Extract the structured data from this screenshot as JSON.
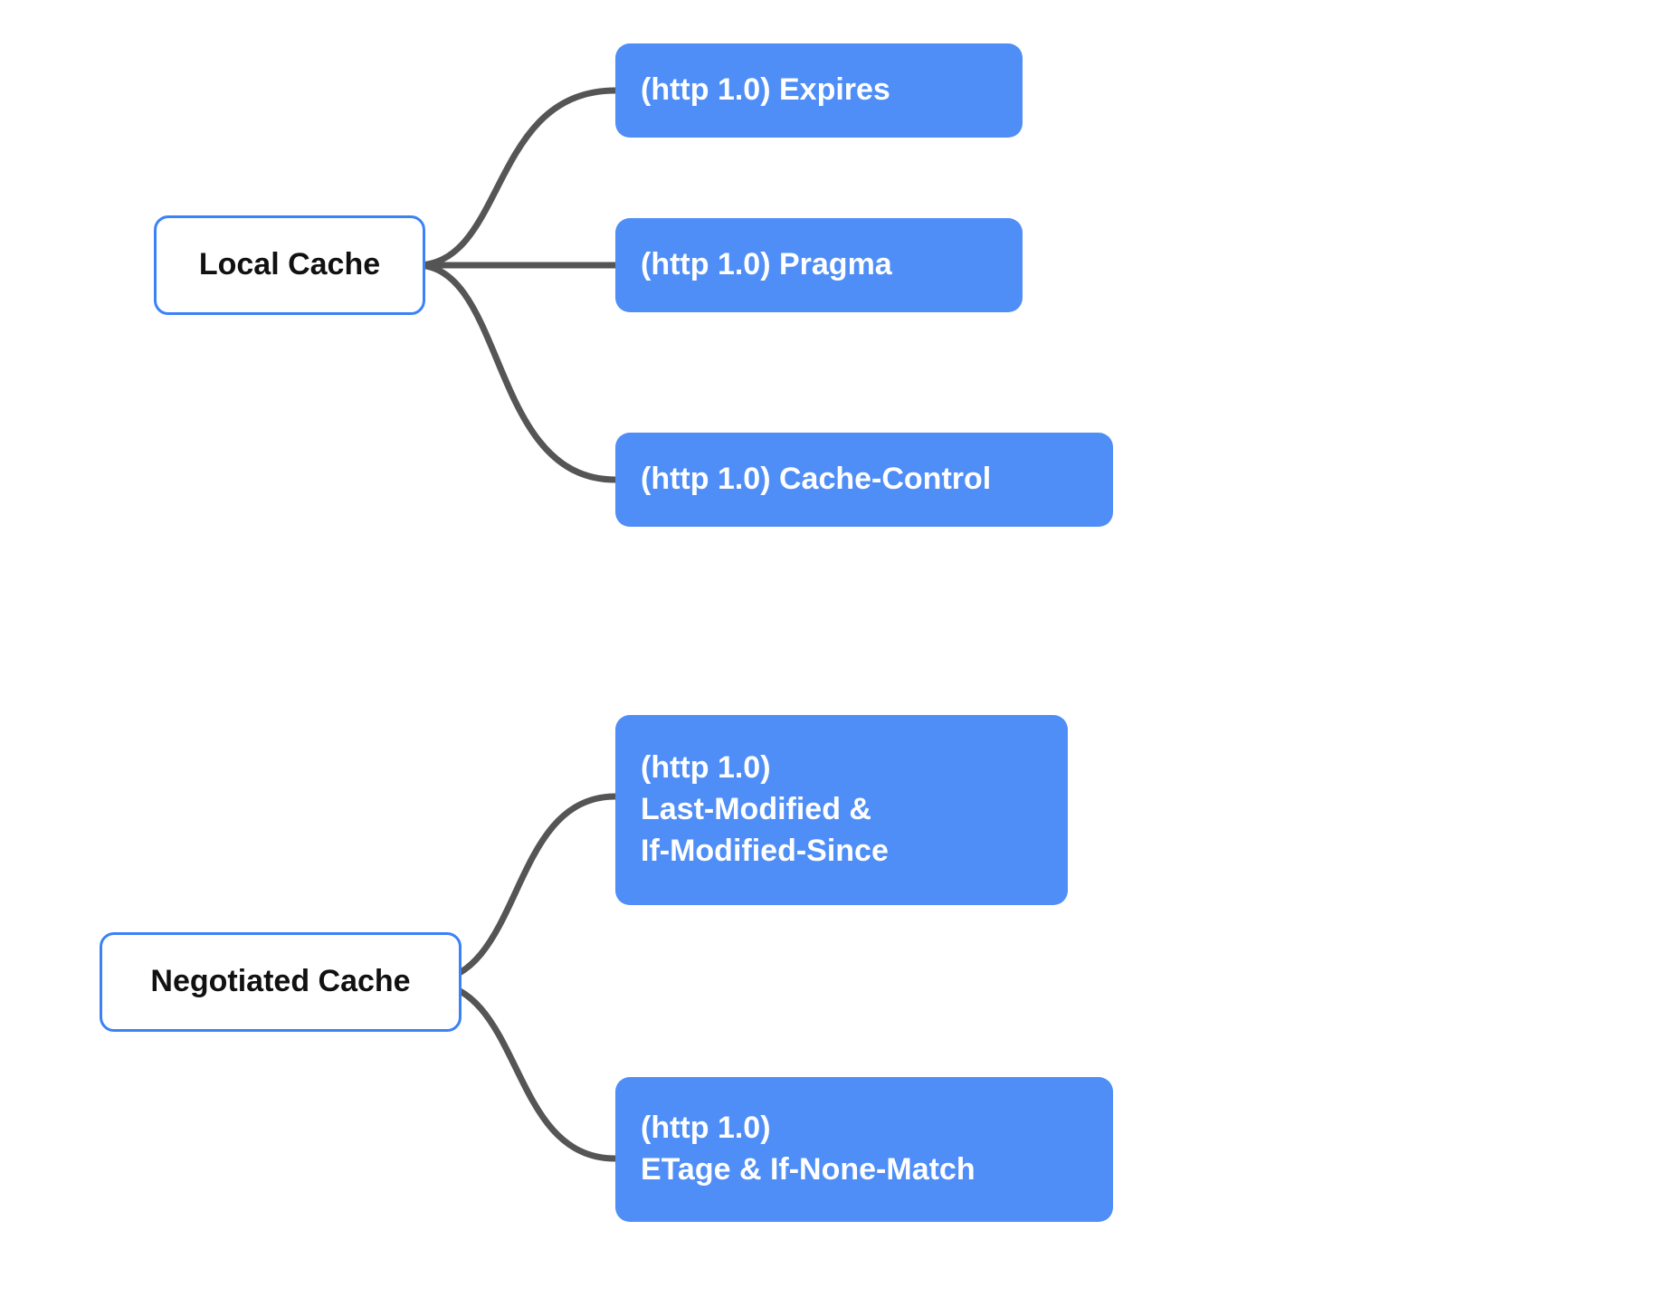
{
  "diagram": {
    "groups": [
      {
        "root": "Local Cache",
        "children": [
          "(http 1.0) Expires",
          "(http 1.0) Pragma",
          "(http 1.0) Cache-Control"
        ]
      },
      {
        "root": "Negotiated Cache",
        "children": [
          "(http 1.0)\nLast-Modified &\nIf-Modified-Since",
          "(http 1.0)\nETage & If-None-Match"
        ]
      }
    ]
  }
}
